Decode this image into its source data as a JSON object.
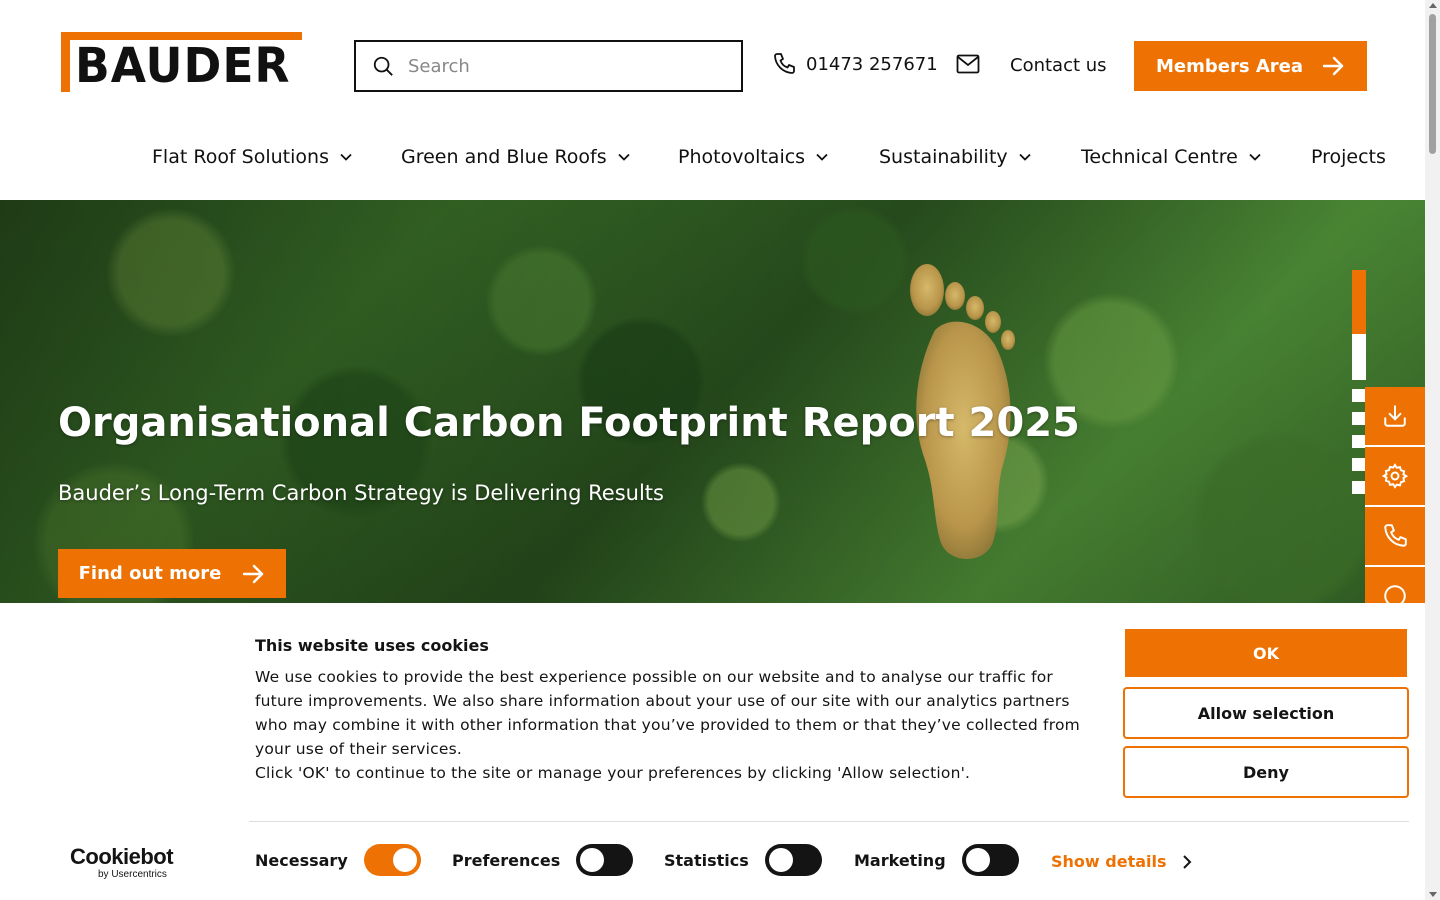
{
  "brand": {
    "logo_text": "BAUDER",
    "accent_color": "#ee7203"
  },
  "header": {
    "search_placeholder": "Search",
    "phone": "01473 257671",
    "contact_label": "Contact us",
    "members_label": "Members Area"
  },
  "nav": {
    "items": [
      {
        "label": "Flat Roof Solutions",
        "has_dropdown": true
      },
      {
        "label": "Green and Blue Roofs",
        "has_dropdown": true
      },
      {
        "label": "Photovoltaics",
        "has_dropdown": true
      },
      {
        "label": "Sustainability",
        "has_dropdown": true
      },
      {
        "label": "Technical Centre",
        "has_dropdown": true
      },
      {
        "label": "Projects",
        "has_dropdown": false
      }
    ]
  },
  "hero": {
    "title": "Organisational Carbon Footprint Report 2025",
    "subtitle": "Bauder’s Long-Term Carbon Strategy is Delivering Results",
    "cta_label": "Find out more",
    "slide_count": 7,
    "active_slide": 1
  },
  "side_tools": [
    "download-icon",
    "gear-icon",
    "phone-icon",
    "chat-icon"
  ],
  "cookie": {
    "title": "This website uses cookies",
    "body": "We use cookies to provide the best experience possible on our website and to analyse our traffic for future improvements. We also share information about your use of our site with our analytics partners who may combine it with other information that you’ve provided to them or that they’ve collected from your use of their services.",
    "body2": "Click 'OK' to continue to the site or manage your preferences by clicking 'Allow selection'.",
    "ok_label": "OK",
    "allow_selection_label": "Allow selection",
    "deny_label": "Deny",
    "brand_main": "Cookiebot",
    "brand_sub": "by Usercentrics",
    "toggles": [
      {
        "label": "Necessary",
        "on": true
      },
      {
        "label": "Preferences",
        "on": false
      },
      {
        "label": "Statistics",
        "on": false
      },
      {
        "label": "Marketing",
        "on": false
      }
    ],
    "show_details_label": "Show details"
  }
}
